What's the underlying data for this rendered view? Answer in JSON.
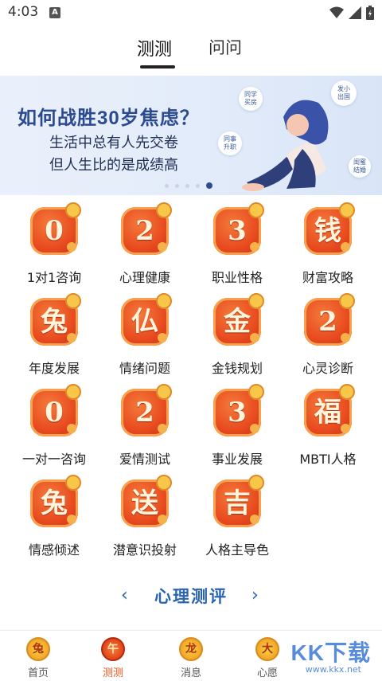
{
  "status_bar": {
    "time": "4:03",
    "notif": "A"
  },
  "top_tabs": {
    "active": "测测",
    "inactive": "问问"
  },
  "banner": {
    "title": "如何战胜30岁焦虑？",
    "line1": "生活中总有人先交卷",
    "line2": "但人生比的是成绩高",
    "bubbles": [
      "同学\n买房",
      "发小\n出国",
      "同事\n升职",
      "闺蜜\n结婚"
    ],
    "dots": 5,
    "active_dot": 4
  },
  "grid": [
    {
      "glyph": "0",
      "label": "1对1咨询"
    },
    {
      "glyph": "2",
      "label": "心理健康"
    },
    {
      "glyph": "3",
      "label": "职业性格"
    },
    {
      "glyph": "钱",
      "label": "财富攻略"
    },
    {
      "glyph": "兔",
      "label": "年度发展"
    },
    {
      "glyph": "仏",
      "label": "情绪问题"
    },
    {
      "glyph": "金",
      "label": "金钱规划"
    },
    {
      "glyph": "2",
      "label": "心灵诊断"
    },
    {
      "glyph": "0",
      "label": "一对一咨询"
    },
    {
      "glyph": "2",
      "label": "爱情测试"
    },
    {
      "glyph": "3",
      "label": "事业发展"
    },
    {
      "glyph": "福",
      "label": "MBTI人格"
    },
    {
      "glyph": "兔",
      "label": "情感倾述"
    },
    {
      "glyph": "送",
      "label": "潜意识投射"
    },
    {
      "glyph": "吉",
      "label": "人格主导色"
    }
  ],
  "section": {
    "title": "心理测评",
    "left": "‹",
    "right": "›"
  },
  "bottom_nav": [
    {
      "icon": "兔",
      "label": "首页",
      "active": false
    },
    {
      "icon": "午",
      "label": "测测",
      "active": true
    },
    {
      "icon": "龙",
      "label": "消息",
      "active": false
    },
    {
      "icon": "大",
      "label": "心愿",
      "active": false
    }
  ],
  "watermark": {
    "main": "KK下载",
    "sub": "www.kkx.net"
  },
  "colors": {
    "accent": "#e2521c",
    "banner_title": "#2b4a8f",
    "section": "#2a63b0"
  }
}
